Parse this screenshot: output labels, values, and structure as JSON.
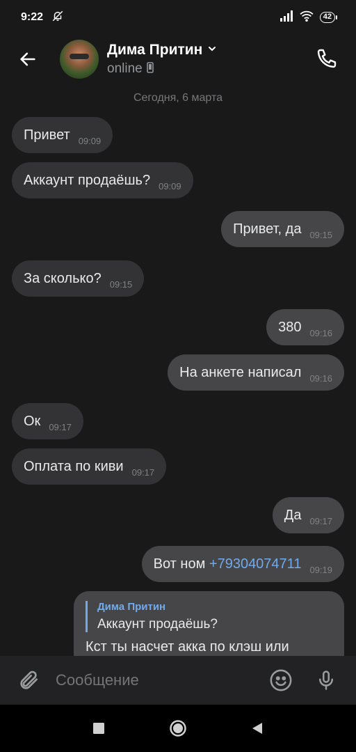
{
  "status_bar": {
    "time": "9:22",
    "battery": "42",
    "icons": [
      "bell-off-icon",
      "signal-icon",
      "wifi-icon",
      "battery-icon"
    ]
  },
  "header": {
    "contact_name": "Дима Притин",
    "status": "online",
    "icons": [
      "back-arrow-icon",
      "chevron-down-icon",
      "phone-icon",
      "mobile-device-icon"
    ]
  },
  "chat": {
    "date_separator": "Сегодня, 6 марта",
    "messages": [
      {
        "direction": "in",
        "text": "Привет",
        "time": "09:09"
      },
      {
        "direction": "in",
        "text": "Аккаунт продаёшь?",
        "time": "09:09"
      },
      {
        "direction": "out",
        "text": "Привет, да",
        "time": "09:15"
      },
      {
        "direction": "in",
        "text": "За сколько?",
        "time": "09:15"
      },
      {
        "direction": "out",
        "text": "380",
        "time": "09:16"
      },
      {
        "direction": "out",
        "text": "На анкете написал",
        "time": "09:16"
      },
      {
        "direction": "in",
        "text": "Ок",
        "time": "09:17"
      },
      {
        "direction": "in",
        "text": "Оплата по киви",
        "time": "09:17"
      },
      {
        "direction": "out",
        "text": "Да",
        "time": "09:17"
      },
      {
        "direction": "out",
        "text": "Вот ном",
        "link": "+79304074711",
        "time": "09:19"
      }
    ],
    "reply": {
      "quote_author": "Дима Притин",
      "quote_text": "Аккаунт продаёшь?",
      "text": "Кст ты насчет акка по клэш или"
    }
  },
  "composer": {
    "placeholder": "Сообщение",
    "icons": [
      "paperclip-icon",
      "emoji-icon",
      "microphone-icon"
    ]
  },
  "navbar": {
    "icons": [
      "recents-icon",
      "home-icon",
      "back-icon"
    ]
  },
  "colors": {
    "background": "#19191a",
    "bubble_in": "#333335",
    "bubble_out": "#464649",
    "link": "#71aaeb",
    "secondary_text": "#939699"
  }
}
